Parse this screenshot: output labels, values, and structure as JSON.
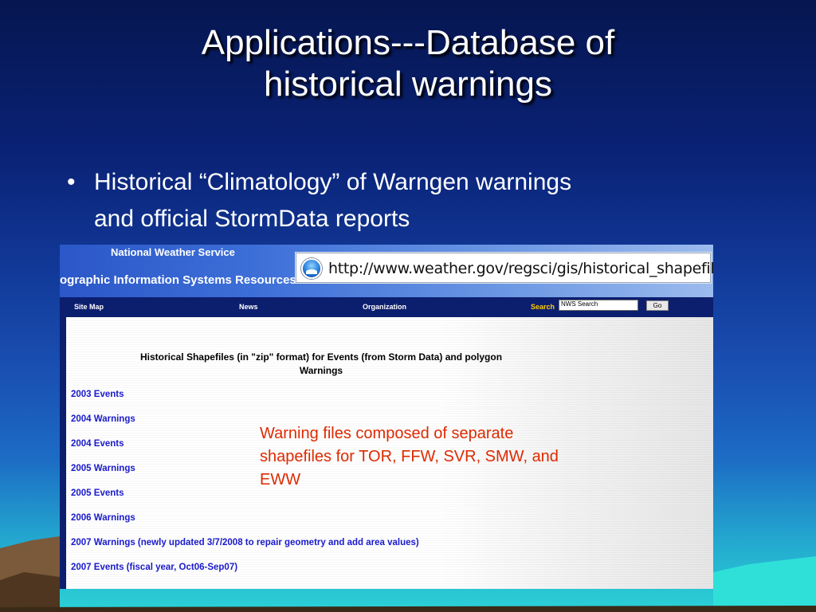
{
  "slide": {
    "title_line1": "Applications---Database of",
    "title_line2": "historical warnings",
    "bullet_symbol": "•",
    "bullet_line1": "Historical “Climatology” of Warngen warnings",
    "bullet_line2": "and official StormData reports"
  },
  "screenshot": {
    "agency": "National Weather Service",
    "gis_banner": "ographic Information Systems Resources",
    "url": "http://www.weather.gov/regsci/gis/historical_shapefiles/",
    "nav": {
      "site_map": "Site Map",
      "news": "News",
      "organization": "Organization",
      "search_label": "Search",
      "search_value": "NWS Search",
      "go": "Go"
    },
    "heading_line1": "Historical Shapefiles (in \"zip\" format) for Events (from Storm Data) and polygon",
    "heading_line2": "Warnings",
    "links": [
      "2003 Events",
      "2004 Warnings",
      "2004 Events",
      "2005 Warnings",
      "2005 Events",
      "2006 Warnings",
      "2007 Warnings (newly updated 3/7/2008 to repair geometry and add area values)",
      "2007 Events (fiscal year, Oct06-Sep07)"
    ]
  },
  "note": {
    "line1": "Warning files composed of separate",
    "line2": "shapefiles for TOR, FFW, SVR, SMW, and",
    "line3": "EWW"
  },
  "colors": {
    "note_text": "#dd2a00",
    "link": "#1a1acc",
    "nav_bar": "#0c1e6e"
  }
}
